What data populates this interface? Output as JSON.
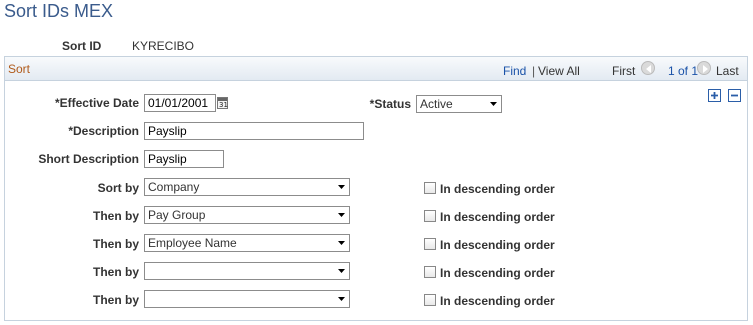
{
  "page": {
    "title": "Sort IDs MEX"
  },
  "sort_id": {
    "label": "Sort ID",
    "value": "KYRECIBO"
  },
  "panel": {
    "title": "Sort",
    "nav": {
      "find": "Find",
      "separator": "|",
      "view_all": "View All",
      "first": "First",
      "count": "1 of 1",
      "last": "Last"
    },
    "effective_date": {
      "label": "*Effective Date",
      "value": "01/01/2001",
      "calendar_glyph": "31"
    },
    "status": {
      "label": "*Status",
      "value": "Active"
    },
    "description": {
      "label": "*Description",
      "value": "Payslip"
    },
    "short_description": {
      "label": "Short Description",
      "value": "Payslip"
    },
    "sort_rows": [
      {
        "label": "Sort by",
        "value": "Company",
        "checkbox_label": "In descending order",
        "checked": false
      },
      {
        "label": "Then by",
        "value": "Pay Group",
        "checkbox_label": "In descending order",
        "checked": false
      },
      {
        "label": "Then by",
        "value": "Employee Name",
        "checkbox_label": "In descending order",
        "checked": false
      },
      {
        "label": "Then by",
        "value": "",
        "checkbox_label": "In descending order",
        "checked": false
      },
      {
        "label": "Then by",
        "value": "",
        "checkbox_label": "In descending order",
        "checked": false
      }
    ]
  },
  "icons": {
    "calendar": "calendar-icon",
    "add_row": "plus-icon",
    "delete_row": "minus-icon",
    "prev": "chevron-left-icon",
    "next": "chevron-right-icon",
    "dropdown": "chevron-down-icon"
  },
  "colors": {
    "title": "#3a5b8c",
    "panel_title": "#b05a1a",
    "link": "#1a52a8",
    "panel_border": "#c6d2de"
  }
}
